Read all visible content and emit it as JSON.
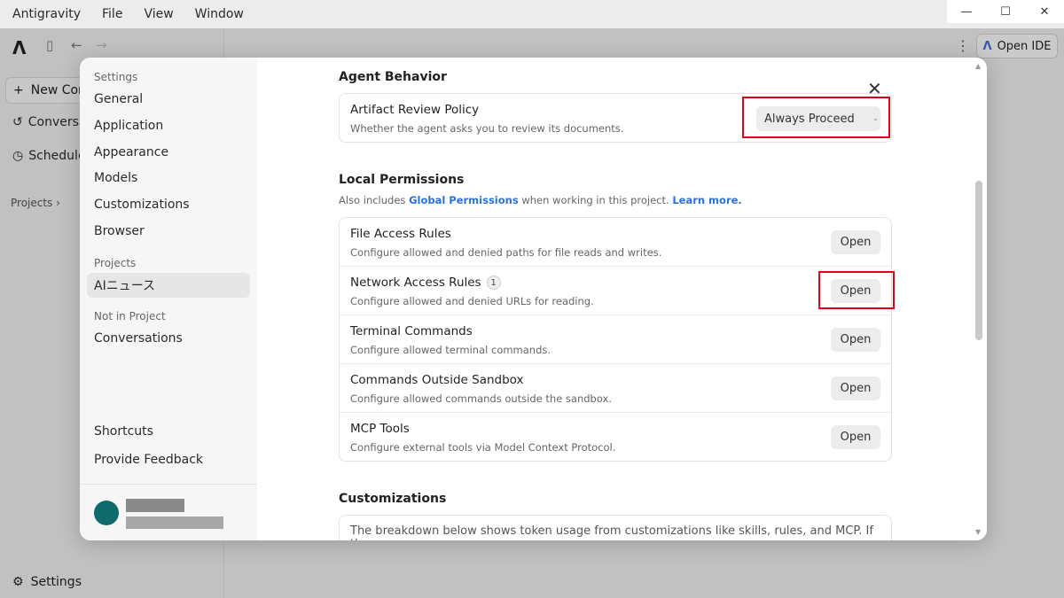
{
  "menubar": {
    "items": [
      "Antigravity",
      "File",
      "View",
      "Window"
    ]
  },
  "window_controls": {
    "minimize": "—",
    "maximize": "☐",
    "close": "✕"
  },
  "bg_sidebar": {
    "new_conversation": "New Cor",
    "conversations": "Conversa",
    "scheduled": "Schedule",
    "projects": "Projects",
    "settings": "Settings"
  },
  "header": {
    "open_ide_label": "Open IDE",
    "more_icon": "⋮"
  },
  "settings_nav": {
    "section_settings": "Settings",
    "items": [
      "General",
      "Application",
      "Appearance",
      "Models",
      "Customizations",
      "Browser"
    ],
    "section_projects": "Projects",
    "project_item": "AIニュース",
    "section_not_in_project": "Not in Project",
    "not_in_project_item": "Conversations",
    "shortcuts": "Shortcuts",
    "feedback": "Provide Feedback"
  },
  "agent_behavior": {
    "title": "Agent Behavior",
    "artifact_review": {
      "title": "Artifact Review Policy",
      "desc": "Whether the agent asks you to review its documents.",
      "value": "Always Proceed"
    }
  },
  "local_permissions": {
    "title": "Local Permissions",
    "desc_prefix": "Also includes ",
    "desc_link": "Global Permissions",
    "desc_middle": " when working in this project. ",
    "desc_learn": "Learn more.",
    "rows": [
      {
        "title": "File Access Rules",
        "desc": "Configure allowed and denied paths for file reads and writes.",
        "badge": "",
        "button": "Open"
      },
      {
        "title": "Network Access Rules",
        "desc": "Configure allowed and denied URLs for reading.",
        "badge": "1",
        "button": "Open"
      },
      {
        "title": "Terminal Commands",
        "desc": "Configure allowed terminal commands.",
        "badge": "",
        "button": "Open"
      },
      {
        "title": "Commands Outside Sandbox",
        "desc": "Configure allowed commands outside the sandbox.",
        "badge": "",
        "button": "Open"
      },
      {
        "title": "MCP Tools",
        "desc": "Configure external tools via Model Context Protocol.",
        "badge": "",
        "button": "Open"
      }
    ]
  },
  "customizations": {
    "title": "Customizations",
    "desc": "The breakdown below shows token usage from customizations like skills, rules, and MCP. If the"
  },
  "colors": {
    "highlight": "#e0001a",
    "link": "#2d72d9",
    "avatar": "#0f6b6b"
  }
}
